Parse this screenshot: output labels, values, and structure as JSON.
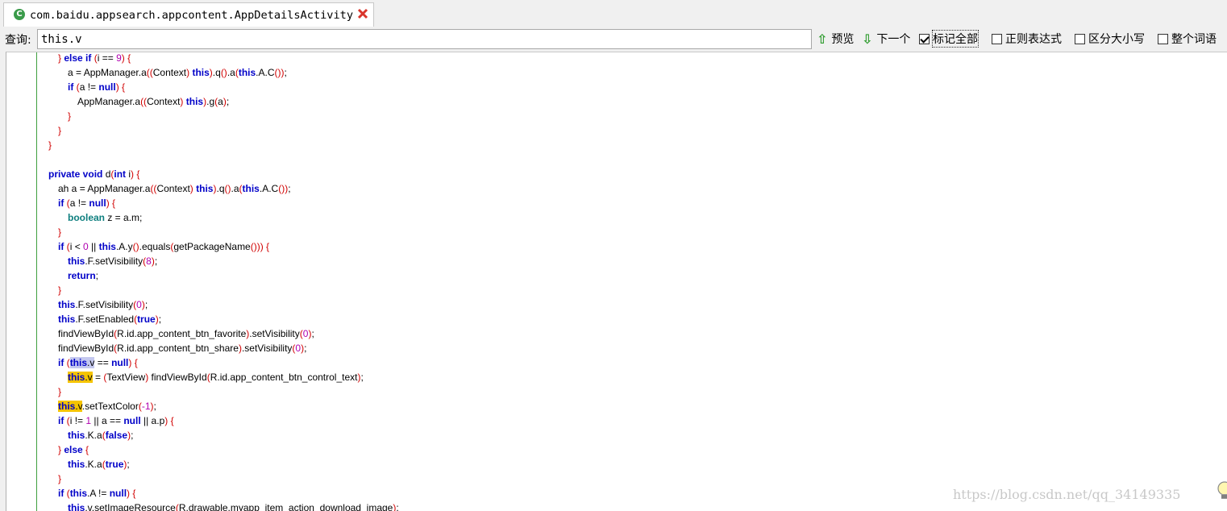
{
  "tab": {
    "title": "com.baidu.appsearch.appcontent.AppDetailsActivity",
    "icon": "class-icon",
    "close_icon": "close-icon"
  },
  "search": {
    "label": "查询:",
    "value": "this.v",
    "prev_label": "预览",
    "next_label": "下一个",
    "mark_all_label": "标记全部",
    "mark_all_checked": true,
    "regex_label": "正则表达式",
    "regex_checked": false,
    "case_label": "区分大小写",
    "case_checked": false,
    "whole_word_label": "整个词语",
    "whole_word_checked": false
  },
  "code": {
    "lines": [
      {
        "indent": 64,
        "segs": [
          [
            "p",
            "} "
          ],
          [
            "kw",
            "else if"
          ],
          [
            "p",
            " ("
          ],
          [
            "",
            "i == "
          ],
          [
            "n",
            "9"
          ],
          [
            "p",
            ") {"
          ]
        ]
      },
      {
        "indent": 76,
        "segs": [
          [
            "",
            "a = AppManager.a"
          ],
          [
            "p",
            "(("
          ],
          [
            "",
            "Context"
          ],
          [
            "p",
            ") "
          ],
          [
            "kw",
            "this"
          ],
          [
            "p",
            ")"
          ],
          [
            "",
            ".q"
          ],
          [
            "p",
            "()"
          ],
          [
            "",
            ".a"
          ],
          [
            "p",
            "("
          ],
          [
            "kw",
            "this"
          ],
          [
            "",
            ".A.C"
          ],
          [
            "p",
            "())"
          ],
          [
            "",
            ";"
          ]
        ]
      },
      {
        "indent": 76,
        "segs": [
          [
            "kw",
            "if"
          ],
          [
            "p",
            " ("
          ],
          [
            "",
            "a != "
          ],
          [
            "kw",
            "null"
          ],
          [
            "p",
            ") {"
          ]
        ]
      },
      {
        "indent": 88,
        "segs": [
          [
            "",
            "AppManager.a"
          ],
          [
            "p",
            "(("
          ],
          [
            "",
            "Context"
          ],
          [
            "p",
            ") "
          ],
          [
            "kw",
            "this"
          ],
          [
            "p",
            ")"
          ],
          [
            "",
            ".g"
          ],
          [
            "p",
            "("
          ],
          [
            "",
            "a"
          ],
          [
            "p",
            ")"
          ],
          [
            "",
            ";"
          ]
        ]
      },
      {
        "indent": 76,
        "segs": [
          [
            "p",
            "}"
          ]
        ]
      },
      {
        "indent": 64,
        "segs": [
          [
            "p",
            "}"
          ]
        ]
      },
      {
        "indent": 52,
        "segs": [
          [
            "p",
            "}"
          ]
        ]
      },
      {
        "indent": 52,
        "segs": []
      },
      {
        "indent": 52,
        "segs": [
          [
            "kw",
            "private void"
          ],
          [
            "",
            " d"
          ],
          [
            "p",
            "("
          ],
          [
            "kw",
            "int"
          ],
          [
            "",
            " i"
          ],
          [
            "p",
            ") {"
          ]
        ]
      },
      {
        "indent": 64,
        "segs": [
          [
            "",
            "ah a = AppManager.a"
          ],
          [
            "p",
            "(("
          ],
          [
            "",
            "Context"
          ],
          [
            "p",
            ") "
          ],
          [
            "kw",
            "this"
          ],
          [
            "p",
            ")"
          ],
          [
            "",
            ".q"
          ],
          [
            "p",
            "()"
          ],
          [
            "",
            ".a"
          ],
          [
            "p",
            "("
          ],
          [
            "kw",
            "this"
          ],
          [
            "",
            ".A.C"
          ],
          [
            "p",
            "())"
          ],
          [
            "",
            ";"
          ]
        ]
      },
      {
        "indent": 64,
        "segs": [
          [
            "kw",
            "if"
          ],
          [
            "p",
            " ("
          ],
          [
            "",
            "a != "
          ],
          [
            "kw",
            "null"
          ],
          [
            "p",
            ") {"
          ]
        ]
      },
      {
        "indent": 76,
        "segs": [
          [
            "kw2",
            "boolean"
          ],
          [
            "",
            " z = a.m;"
          ]
        ]
      },
      {
        "indent": 64,
        "segs": [
          [
            "p",
            "}"
          ]
        ]
      },
      {
        "indent": 64,
        "segs": [
          [
            "kw",
            "if"
          ],
          [
            "p",
            " ("
          ],
          [
            "",
            "i < "
          ],
          [
            "n",
            "0"
          ],
          [
            "",
            " || "
          ],
          [
            "kw",
            "this"
          ],
          [
            "",
            ".A.y"
          ],
          [
            "p",
            "()"
          ],
          [
            "",
            ".equals"
          ],
          [
            "p",
            "("
          ],
          [
            "",
            "getPackageName"
          ],
          [
            "p",
            "())) {"
          ]
        ]
      },
      {
        "indent": 76,
        "segs": [
          [
            "kw",
            "this"
          ],
          [
            "",
            ".F.setVisibility"
          ],
          [
            "p",
            "("
          ],
          [
            "n",
            "8"
          ],
          [
            "p",
            ")"
          ],
          [
            "",
            ";"
          ]
        ]
      },
      {
        "indent": 76,
        "segs": [
          [
            "kw",
            "return"
          ],
          [
            "",
            ";"
          ]
        ]
      },
      {
        "indent": 64,
        "segs": [
          [
            "p",
            "}"
          ]
        ]
      },
      {
        "indent": 64,
        "segs": [
          [
            "kw",
            "this"
          ],
          [
            "",
            ".F.setVisibility"
          ],
          [
            "p",
            "("
          ],
          [
            "n",
            "0"
          ],
          [
            "p",
            ")"
          ],
          [
            "",
            ";"
          ]
        ]
      },
      {
        "indent": 64,
        "segs": [
          [
            "kw",
            "this"
          ],
          [
            "",
            ".F.setEnabled"
          ],
          [
            "p",
            "("
          ],
          [
            "kw",
            "true"
          ],
          [
            "p",
            ")"
          ],
          [
            "",
            ";"
          ]
        ]
      },
      {
        "indent": 64,
        "segs": [
          [
            "",
            "findViewById"
          ],
          [
            "p",
            "("
          ],
          [
            "",
            "R.id.app_content_btn_favorite"
          ],
          [
            "p",
            ")"
          ],
          [
            "",
            ".setVisibility"
          ],
          [
            "p",
            "("
          ],
          [
            "n",
            "0"
          ],
          [
            "p",
            ")"
          ],
          [
            "",
            ";"
          ]
        ]
      },
      {
        "indent": 64,
        "segs": [
          [
            "",
            "findViewById"
          ],
          [
            "p",
            "("
          ],
          [
            "",
            "R.id.app_content_btn_share"
          ],
          [
            "p",
            ")"
          ],
          [
            "",
            ".setVisibility"
          ],
          [
            "p",
            "("
          ],
          [
            "n",
            "0"
          ],
          [
            "p",
            ")"
          ],
          [
            "",
            ";"
          ]
        ]
      },
      {
        "indent": 64,
        "segs": [
          [
            "kw",
            "if"
          ],
          [
            "p",
            " ("
          ],
          [
            "kw mark2",
            "this"
          ],
          [
            "mark2",
            ".v"
          ],
          [
            "",
            " == "
          ],
          [
            "kw",
            "null"
          ],
          [
            "p",
            ") {"
          ]
        ]
      },
      {
        "indent": 76,
        "segs": [
          [
            "kw mark",
            "this"
          ],
          [
            "mark",
            ".v"
          ],
          [
            "",
            " = "
          ],
          [
            "p",
            "("
          ],
          [
            "",
            "TextView"
          ],
          [
            "p",
            ") "
          ],
          [
            "",
            "findViewById"
          ],
          [
            "p",
            "("
          ],
          [
            "",
            "R.id.app_content_btn_control_text"
          ],
          [
            "p",
            ")"
          ],
          [
            "",
            ";"
          ]
        ]
      },
      {
        "indent": 64,
        "segs": [
          [
            "p",
            "}"
          ]
        ]
      },
      {
        "indent": 64,
        "segs": [
          [
            "kw mark",
            "this"
          ],
          [
            "mark",
            ".v"
          ],
          [
            "",
            ".setTextColor"
          ],
          [
            "p",
            "("
          ],
          [
            "n",
            "-1"
          ],
          [
            "p",
            ")"
          ],
          [
            "",
            ";"
          ]
        ]
      },
      {
        "indent": 64,
        "segs": [
          [
            "kw",
            "if"
          ],
          [
            "p",
            " ("
          ],
          [
            "",
            "i != "
          ],
          [
            "n",
            "1"
          ],
          [
            "",
            " || a == "
          ],
          [
            "kw",
            "null"
          ],
          [
            "",
            " || a.p"
          ],
          [
            "p",
            ") {"
          ]
        ]
      },
      {
        "indent": 76,
        "segs": [
          [
            "kw",
            "this"
          ],
          [
            "",
            ".K.a"
          ],
          [
            "p",
            "("
          ],
          [
            "kw",
            "false"
          ],
          [
            "p",
            ")"
          ],
          [
            "",
            ";"
          ]
        ]
      },
      {
        "indent": 64,
        "segs": [
          [
            "p",
            "} "
          ],
          [
            "kw",
            "else"
          ],
          [
            "p",
            " {"
          ]
        ]
      },
      {
        "indent": 76,
        "segs": [
          [
            "kw",
            "this"
          ],
          [
            "",
            ".K.a"
          ],
          [
            "p",
            "("
          ],
          [
            "kw",
            "true"
          ],
          [
            "p",
            ")"
          ],
          [
            "",
            ";"
          ]
        ]
      },
      {
        "indent": 64,
        "segs": [
          [
            "p",
            "}"
          ]
        ]
      },
      {
        "indent": 64,
        "segs": [
          [
            "kw",
            "if"
          ],
          [
            "p",
            " ("
          ],
          [
            "kw",
            "this"
          ],
          [
            "",
            ".A != "
          ],
          [
            "kw",
            "null"
          ],
          [
            "p",
            ") {"
          ]
        ]
      },
      {
        "indent": 76,
        "segs": [
          [
            "kw",
            "this"
          ],
          [
            "",
            ".v.setImageResource"
          ],
          [
            "p",
            "("
          ],
          [
            "",
            "R.drawable.myapp_item_action_download_image"
          ],
          [
            "p",
            ")"
          ],
          [
            "",
            ";"
          ]
        ]
      }
    ]
  },
  "watermark": "https://blog.csdn.net/qq_34149335",
  "lightbulb_icon": "lightbulb-icon"
}
